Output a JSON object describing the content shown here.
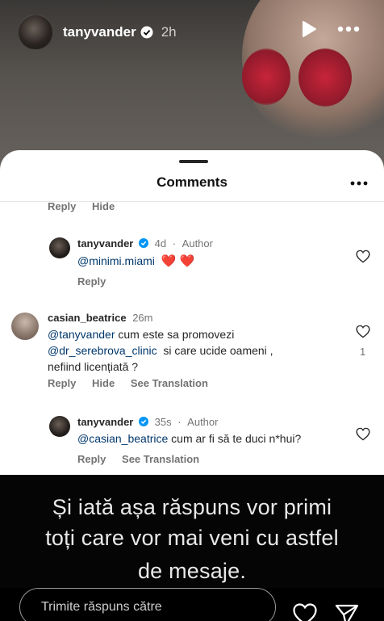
{
  "story": {
    "username": "tanyvander",
    "time": "2h",
    "icons": {
      "verified": "verified-badge-icon",
      "play": "play-icon",
      "more": "more-horizontal-icon"
    }
  },
  "comments_sheet": {
    "title": "Comments",
    "top_actions": {
      "reply": "Reply",
      "hide": "Hide"
    },
    "items": [
      {
        "username": "tanyvander",
        "time": "4d",
        "author_label": "Author",
        "mention": "@minimi.miami",
        "text": "",
        "emoji": "❤️ ❤️",
        "actions": {
          "reply": "Reply"
        }
      },
      {
        "username": "casian_beatrice",
        "time": "26m",
        "line1_mention": "@tanyvander",
        "line1_text": " cum este sa promovezi",
        "line2_mention": "@dr_serebrova_clinic",
        "line2_text": "  si care ucide oameni ,",
        "line3_text": "nefiind licențiată ?",
        "likes": "1",
        "actions": {
          "reply": "Reply",
          "hide": "Hide",
          "translate": "See Translation"
        }
      },
      {
        "username": "tanyvander",
        "time": "35s",
        "author_label": "Author",
        "mention": "@casian_beatrice",
        "text": " cum ar fi să te duci n*hui?",
        "actions": {
          "reply": "Reply",
          "translate": "See Translation"
        }
      }
    ]
  },
  "caption": {
    "line1": "Și iată așa răspuns vor primi",
    "line2": "toți care vor mai veni cu astfel",
    "line3": "de mesaje."
  },
  "reply_bar": {
    "placeholder": "Trimite răspuns către",
    "icons": {
      "like": "heart-icon",
      "send": "send-icon"
    }
  },
  "colors": {
    "mention": "#00376b",
    "heart_red": "#e0232e",
    "verified_blue": "#0095f6"
  }
}
